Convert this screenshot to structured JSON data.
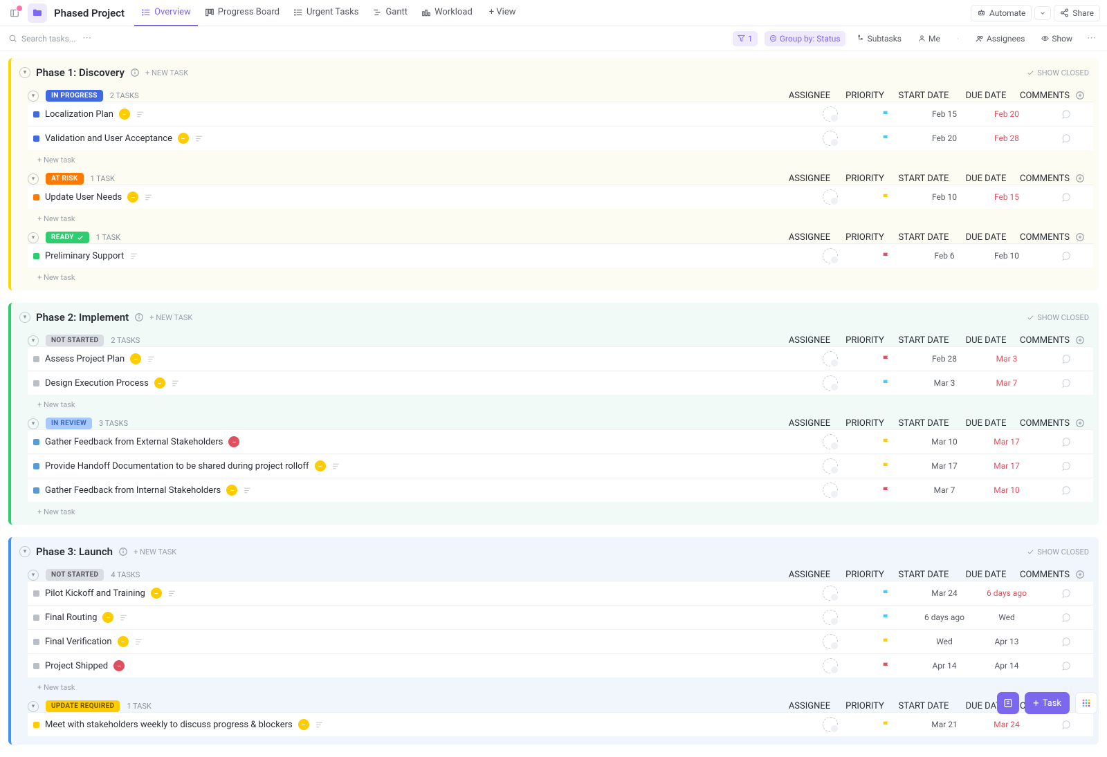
{
  "header": {
    "project_title": "Phased Project",
    "tabs": [
      {
        "label": "Overview",
        "active": true
      },
      {
        "label": "Progress Board"
      },
      {
        "label": "Urgent Tasks"
      },
      {
        "label": "Gantt"
      },
      {
        "label": "Workload"
      }
    ],
    "add_view": "+ View",
    "automate": "Automate",
    "share": "Share"
  },
  "filter": {
    "search_placeholder": "Search tasks...",
    "filter_count": "1",
    "group_by": "Group by: Status",
    "subtasks": "Subtasks",
    "me": "Me",
    "assignees": "Assignees",
    "show": "Show"
  },
  "columns": {
    "assignee": "ASSIGNEE",
    "priority": "PRIORITY",
    "start": "START DATE",
    "due": "DUE DATE",
    "comments": "COMMENTS"
  },
  "labels": {
    "new_task": "+ NEW TASK",
    "show_closed": "SHOW CLOSED",
    "new_task_row": "+ New task"
  },
  "fab": {
    "task": "Task"
  },
  "phases": [
    {
      "title": "Phase 1: Discovery",
      "color": "yellow",
      "groups": [
        {
          "status": "IN PROGRESS",
          "pill_bg": "#4169e1",
          "count": "2 TASKS",
          "tasks": [
            {
              "sq": "#4169e1",
              "name": "Localization Plan",
              "badge": "progress",
              "desc": true,
              "flag": "#49ccf9",
              "start": "Feb 15",
              "due": "Feb 20",
              "due_red": true
            },
            {
              "sq": "#4169e1",
              "name": "Validation and User Acceptance",
              "badge": "progress",
              "desc": true,
              "flag": "#49ccf9",
              "start": "Feb 20",
              "due": "Feb 28",
              "due_red": true
            }
          ]
        },
        {
          "status": "AT RISK",
          "pill_bg": "#ff7800",
          "count": "1 TASK",
          "tasks": [
            {
              "sq": "#ff7800",
              "name": "Update User Needs",
              "badge": "progress",
              "desc": true,
              "flag": "#ffcc00",
              "start": "Feb 10",
              "due": "Feb 15",
              "due_red": true
            }
          ]
        },
        {
          "status": "READY",
          "pill_bg": "#2ecd6f",
          "pill_icon": true,
          "count": "1 TASK",
          "tasks": [
            {
              "sq": "#2ecd6f",
              "name": "Preliminary Support",
              "desc": true,
              "flag": "#e04f5f",
              "start": "Feb 6",
              "due": "Feb 10"
            }
          ]
        }
      ]
    },
    {
      "title": "Phase 2: Implement",
      "color": "teal",
      "groups": [
        {
          "status": "NOT STARTED",
          "pill_bg": "#d9dce1",
          "pill_fg": "#54585f",
          "count": "2 TASKS",
          "tasks": [
            {
              "sq": "#b9bec7",
              "name": "Assess Project Plan",
              "badge": "progress",
              "desc": true,
              "flag": "#e04f5f",
              "start": "Feb 28",
              "due": "Mar 3",
              "due_red": true
            },
            {
              "sq": "#b9bec7",
              "name": "Design Execution Process",
              "badge": "progress",
              "desc": true,
              "flag": "#49ccf9",
              "start": "Mar 3",
              "due": "Mar 7",
              "due_red": true
            }
          ]
        },
        {
          "status": "IN REVIEW",
          "pill_bg": "#a9c8ff",
          "pill_fg": "#3a6ab8",
          "count": "3 TASKS",
          "tasks": [
            {
              "sq": "#5b9bd5",
              "name": "Gather Feedback from External Stakeholders",
              "badge": "blocked",
              "flag": "#ffcc00",
              "start": "Mar 10",
              "due": "Mar 17",
              "due_red": true
            },
            {
              "sq": "#5b9bd5",
              "name": "Provide Handoff Documentation to be shared during project rolloff",
              "badge": "progress",
              "desc": true,
              "flag": "#ffcc00",
              "start": "Mar 17",
              "due": "Mar 17",
              "due_red": true
            },
            {
              "sq": "#5b9bd5",
              "name": "Gather Feedback from Internal Stakeholders",
              "badge": "progress",
              "desc": true,
              "flag": "#e04f5f",
              "start": "Mar 7",
              "due": "Mar 10",
              "due_red": true
            }
          ]
        }
      ]
    },
    {
      "title": "Phase 3: Launch",
      "color": "blue",
      "groups": [
        {
          "status": "NOT STARTED",
          "pill_bg": "#d9dce1",
          "pill_fg": "#54585f",
          "count": "4 TASKS",
          "tasks": [
            {
              "sq": "#b9bec7",
              "name": "Pilot Kickoff and Training",
              "badge": "progress",
              "desc": true,
              "flag": "#49ccf9",
              "start": "Mar 24",
              "due": "6 days ago",
              "due_red": true
            },
            {
              "sq": "#b9bec7",
              "name": "Final Routing",
              "badge": "progress",
              "desc": true,
              "flag": "#49ccf9",
              "start": "6 days ago",
              "due": "Wed"
            },
            {
              "sq": "#b9bec7",
              "name": "Final Verification",
              "badge": "progress",
              "desc": true,
              "flag": "#ffcc00",
              "start": "Wed",
              "due": "Apr 13"
            },
            {
              "sq": "#b9bec7",
              "name": "Project Shipped",
              "badge": "blocked",
              "flag": "#e04f5f",
              "start": "Apr 14",
              "due": "Apr 14"
            }
          ]
        },
        {
          "status": "UPDATE REQUIRED",
          "pill_bg": "#ffcc00",
          "pill_fg": "#6b5600",
          "count": "1 TASK",
          "tasks": [
            {
              "sq": "#ffcc00",
              "name": "Meet with stakeholders weekly to discuss progress & blockers",
              "badge": "progress",
              "desc": true,
              "flag": "#ffcc00",
              "start": "Mar 21",
              "due": "Mar 24",
              "due_red": true
            }
          ],
          "no_new": true
        }
      ]
    }
  ]
}
